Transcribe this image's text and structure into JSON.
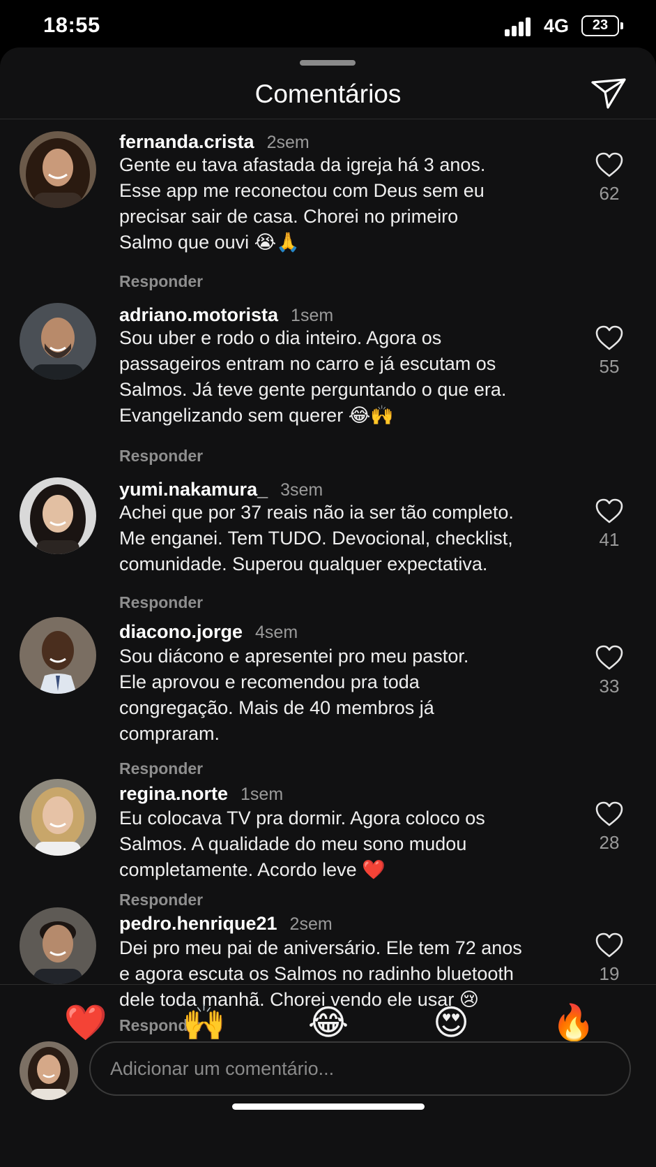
{
  "status_bar": {
    "time": "18:55",
    "network": "4G",
    "battery": "23"
  },
  "header": {
    "title": "Comentários",
    "send_icon": "paper-plane-icon"
  },
  "comments": [
    {
      "username": "fernanda.crista",
      "time": "2sem",
      "text": "Gente eu tava afastada da igreja há 3 anos.\nEsse app me reconectou com Deus sem eu\nprecisar sair de casa. Chorei no primeiro\nSalmo que ouvi 😭🙏",
      "reply": "Responder",
      "likes": "62"
    },
    {
      "username": "adriano.motorista",
      "time": "1sem",
      "text": "Sou uber e rodo o dia inteiro. Agora os\npassageiros entram no carro e já escutam os\nSalmos. Já teve gente perguntando o que era.\nEvangelizando sem querer 😂🙌",
      "reply": "Responder",
      "likes": "55"
    },
    {
      "username": "yumi.nakamura_",
      "time": "3sem",
      "text": "Achei que por 37 reais não ia ser tão completo.\nMe enganei. Tem TUDO. Devocional, checklist,\ncomunidade. Superou qualquer expectativa.",
      "reply": "Responder",
      "likes": "41"
    },
    {
      "username": "diacono.jorge",
      "time": "4sem",
      "text": "Sou diácono e apresentei pro meu pastor.\nEle aprovou e recomendou pra toda\ncongregação. Mais de 40 membros já\ncompraram.",
      "reply": "Responder",
      "likes": "33"
    },
    {
      "username": "regina.norte",
      "time": "1sem",
      "text": "Eu colocava TV pra dormir. Agora coloco os\nSalmos. A qualidade do meu sono mudou\ncompletamente. Acordo leve ❤️",
      "reply": "Responder",
      "likes": "28"
    },
    {
      "username": "pedro.henrique21",
      "time": "2sem",
      "text": "Dei pro meu pai de aniversário. Ele tem 72 anos\ne agora escuta os Salmos no radinho bluetooth\ndele toda manhã. Chorei vendo ele usar 😢",
      "reply": "Responder",
      "likes": "19"
    }
  ],
  "reactions": [
    "❤️",
    "🙌",
    "😂",
    "😍",
    "🔥"
  ],
  "composer": {
    "placeholder": "Adicionar um comentário..."
  },
  "colors": {
    "background": "#000000",
    "sheet": "#111112",
    "muted": "#9a9a9a",
    "border": "#3a3a3a"
  }
}
